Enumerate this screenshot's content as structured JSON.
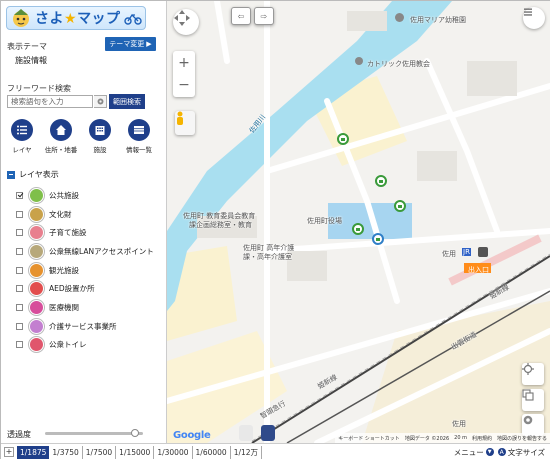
{
  "app": {
    "logo_text": "さよ",
    "logo_text2": "マップ",
    "logo_star": "★"
  },
  "sidebar": {
    "theme_label": "表示テーマ",
    "theme_change_button": "テーマ変更",
    "theme_value": "施設情報",
    "freeword_label": "フリーワード検索",
    "search_placeholder": "検索語句を入力",
    "range_search_button": "範囲検索",
    "nav": [
      {
        "label": "レイヤ",
        "icon": "list-icon"
      },
      {
        "label": "住所・地番",
        "icon": "house-icon"
      },
      {
        "label": "施設",
        "icon": "building-icon"
      },
      {
        "label": "情報一覧",
        "icon": "table-icon"
      }
    ],
    "layer_header": "レイヤ表示",
    "layers": [
      {
        "label": "公共施設",
        "checked": true,
        "color": "#7fbf4a"
      },
      {
        "label": "文化財",
        "checked": false,
        "color": "#c9a24a"
      },
      {
        "label": "子育て施設",
        "checked": false,
        "color": "#e87f8e"
      },
      {
        "label": "公衆無線LANアクセスポイント",
        "checked": false,
        "color": "#b7a87a"
      },
      {
        "label": "観光施設",
        "checked": false,
        "color": "#e6922f"
      },
      {
        "label": "AED設置か所",
        "checked": false,
        "color": "#e24d4d"
      },
      {
        "label": "医療機関",
        "checked": false,
        "color": "#d74d9b"
      },
      {
        "label": "介護サービス事業所",
        "checked": false,
        "color": "#c37fd0"
      },
      {
        "label": "公衆トイレ",
        "checked": false,
        "color": "#e0566c"
      }
    ],
    "opacity_label": "透過度",
    "opacity_value": 0.92
  },
  "map": {
    "labels": {
      "kindergarten": "佐用マリア幼稚園",
      "church": "カトリック佐用教会",
      "river": "佐用川",
      "edu_office_1": "佐用町 教育委員会教育",
      "edu_office_2": "課企画総務室・教育",
      "town_hall": "佐用町役場",
      "care_1": "佐用町 高年介護",
      "care_2": "課・高年介護室",
      "station": "佐用",
      "exit": "出入口",
      "jr": "JR",
      "line_himeji": "姫新線",
      "line_chizu": "智頭急行",
      "line_kishin": "姫新線",
      "road": "出雲街道",
      "area": "佐用"
    },
    "google": "Google",
    "attribution": {
      "shortcuts": "キーボード ショートカット",
      "data": "地図データ ©2026",
      "scale": "20 m",
      "terms": "利用規約",
      "report": "地図の誤りを報告する"
    }
  },
  "scalebar": {
    "scales": [
      "1/1875",
      "1/3750",
      "1/7500",
      "1/15000",
      "1/30000",
      "1/60000",
      "1/12万"
    ],
    "active_index": 0,
    "menu": "メニュー",
    "font_size": "文字サイズ",
    "font_a": "A"
  }
}
